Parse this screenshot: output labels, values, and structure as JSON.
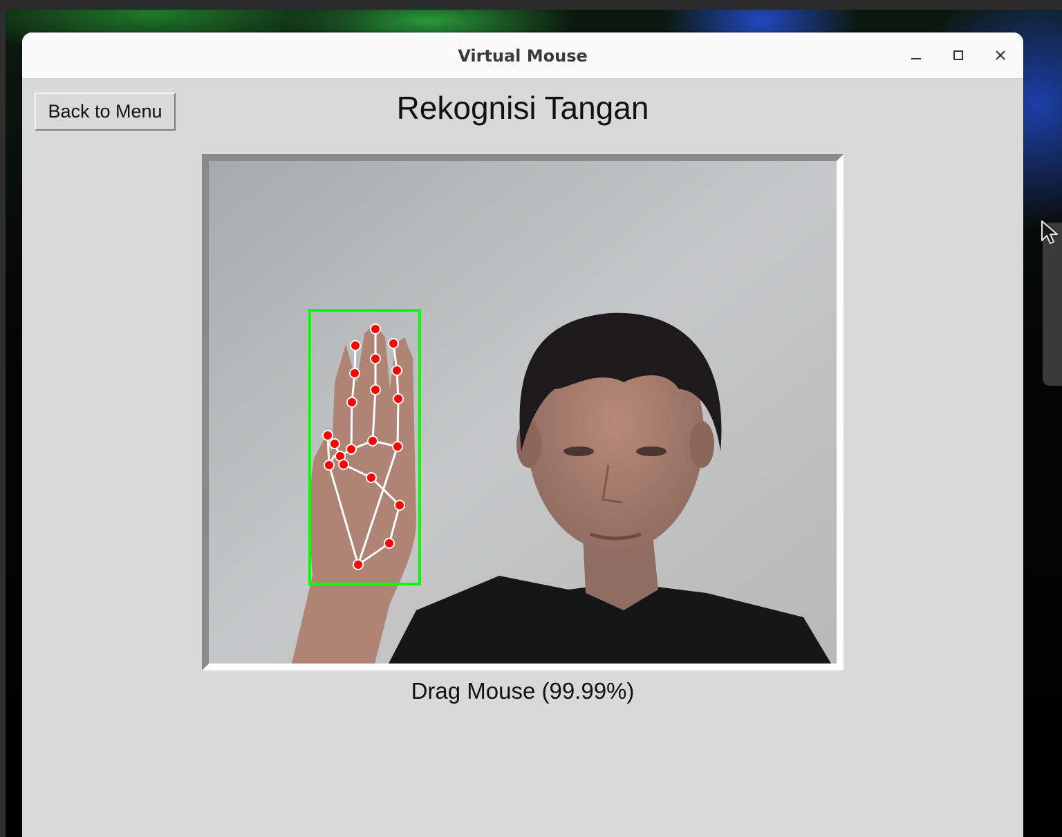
{
  "window": {
    "title": "Virtual Mouse"
  },
  "controls": {
    "back_label": "Back to Menu"
  },
  "page": {
    "heading": "Rekognisi Tangan",
    "status": "Drag Mouse (99.99%)"
  },
  "camera": {
    "bbox_color": "#00ff00",
    "landmark_color": "#ff0000",
    "connection_color": "#ffffff"
  },
  "icons": [
    "minimize-icon",
    "maximize-icon",
    "close-icon",
    "mouse-cursor-icon"
  ]
}
